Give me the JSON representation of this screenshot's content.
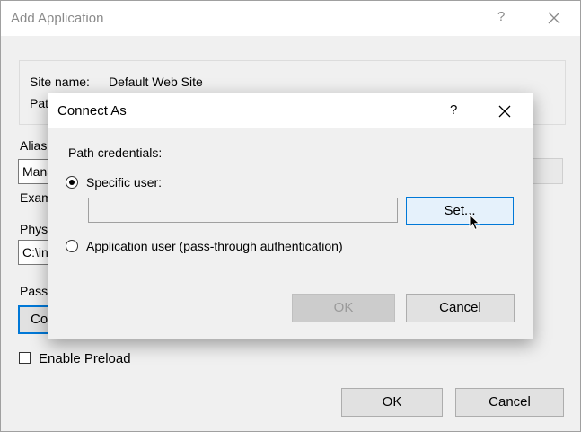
{
  "outer_dialog": {
    "title": "Add Application",
    "help_label": "?",
    "site_name_label": "Site name:",
    "site_name_value": "Default Web Site",
    "path_label": "Pat",
    "alias_label": "Alias",
    "alias_value": "Mana",
    "example_label": "Exam",
    "physical_path_label": "Phys",
    "physical_path_value": "C:\\in",
    "pass_through_label": "Pass-",
    "connect_as_button": "Co",
    "enable_preload_label": "Enable Preload",
    "enable_preload_checked": false,
    "ok_label": "OK",
    "cancel_label": "Cancel"
  },
  "connect_as_dialog": {
    "title": "Connect As",
    "help_label": "?",
    "path_credentials_label": "Path credentials:",
    "specific_user_label": "Specific user:",
    "specific_user_selected": true,
    "specific_user_value": "",
    "set_button_label": "Set...",
    "application_user_label": "Application user (pass-through authentication)",
    "application_user_selected": false,
    "ok_label": "OK",
    "cancel_label": "Cancel"
  },
  "icons": [
    "close-icon",
    "mouse-cursor-icon",
    "radio-selected-icon",
    "radio-unselected-icon",
    "checkbox-icon"
  ],
  "colors": {
    "focus_blue": "#0078d7",
    "hover_blue_bg": "#e5f1fb",
    "dialog_bg": "#f0f0f0",
    "titlebar_bg": "#ffffff"
  }
}
